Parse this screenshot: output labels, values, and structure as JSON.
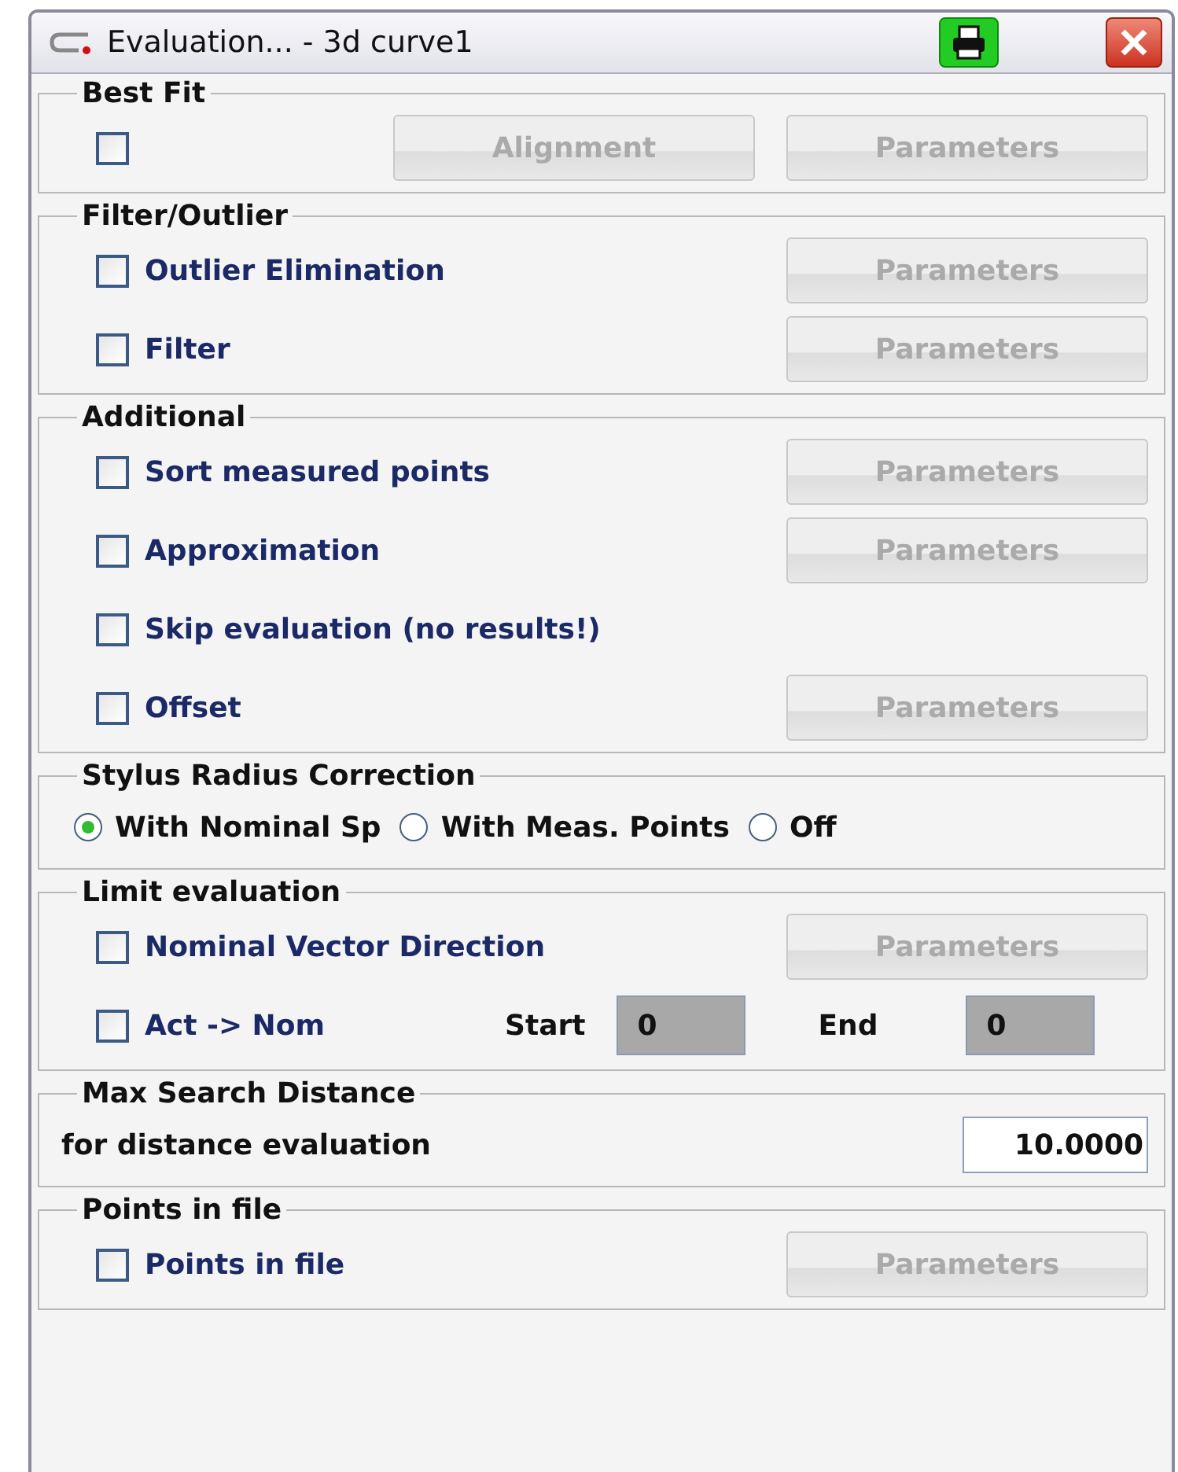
{
  "window": {
    "title": "Evaluation... - 3d curve1"
  },
  "sections": [
    {
      "title": "Best Fit",
      "rows": [
        {
          "kind": "checkbox",
          "checked": false,
          "buttons": [
            {
              "label": "Alignment",
              "disabled": true
            },
            {
              "label": "Parameters",
              "disabled": true
            }
          ]
        }
      ]
    },
    {
      "title": "Filter/Outlier",
      "rows": [
        {
          "kind": "checkbox",
          "label": "Outlier Elimination",
          "checked": false,
          "buttons": [
            {
              "label": "Parameters",
              "disabled": true
            }
          ]
        },
        {
          "kind": "checkbox",
          "label": "Filter",
          "checked": false,
          "buttons": [
            {
              "label": "Parameters",
              "disabled": true
            }
          ]
        }
      ]
    },
    {
      "title": "Additional",
      "rows": [
        {
          "kind": "checkbox",
          "label": "Sort measured points",
          "checked": false,
          "buttons": [
            {
              "label": "Parameters",
              "disabled": true
            }
          ]
        },
        {
          "kind": "checkbox",
          "label": "Approximation",
          "checked": false,
          "buttons": [
            {
              "label": "Parameters",
              "disabled": true
            }
          ]
        },
        {
          "kind": "checkbox",
          "label": "Skip evaluation (no results!)",
          "checked": false
        },
        {
          "kind": "checkbox",
          "label": "Offset",
          "checked": false,
          "buttons": [
            {
              "label": "Parameters",
              "disabled": true
            }
          ]
        }
      ]
    },
    {
      "title": "Stylus Radius Correction",
      "rows": [
        {
          "kind": "radios",
          "options": [
            {
              "label": "With Nominal Sp",
              "selected": true
            },
            {
              "label": "With Meas. Points",
              "selected": false
            },
            {
              "label": "Off",
              "selected": false
            }
          ]
        }
      ]
    },
    {
      "title": "Limit evaluation",
      "rows": [
        {
          "kind": "checkbox",
          "label": "Nominal Vector Direction",
          "checked": false,
          "buttons": [
            {
              "label": "Parameters",
              "disabled": true
            }
          ]
        },
        {
          "kind": "range",
          "label": "Act -> Nom",
          "checked": false,
          "start_label": "Start",
          "start": "0",
          "end_label": "End",
          "end": "0"
        }
      ]
    },
    {
      "title": "Max Search Distance",
      "rows": [
        {
          "kind": "number",
          "label": "for distance evaluation",
          "value": "10.0000"
        }
      ]
    },
    {
      "title": "Points in file",
      "rows": [
        {
          "kind": "checkbox",
          "label": "Points in file",
          "checked": false,
          "buttons": [
            {
              "label": "Parameters",
              "disabled": true
            }
          ]
        }
      ]
    }
  ]
}
